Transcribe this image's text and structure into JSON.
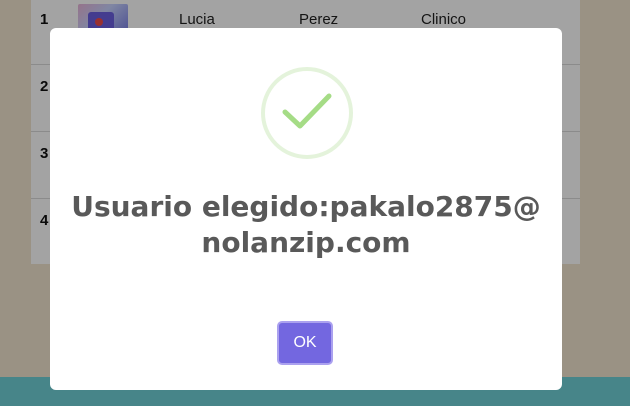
{
  "table": {
    "rows": [
      {
        "num": "1",
        "name": "Lucia",
        "lastname": "Perez",
        "role": "Clinico"
      },
      {
        "num": "2",
        "name": "",
        "lastname": "",
        "role": ""
      },
      {
        "num": "3",
        "name": "",
        "lastname": "",
        "role": ""
      },
      {
        "num": "4",
        "name": "",
        "lastname": "",
        "role": ""
      }
    ]
  },
  "modal": {
    "title": "Usuario elegido:pakalo2875@nolanzip.com",
    "ok_label": "OK",
    "icon": "success-check-icon"
  },
  "colors": {
    "accent": "#7367e0",
    "success": "#a5dc86",
    "overlay": "rgba(0,0,0,0.36)"
  }
}
